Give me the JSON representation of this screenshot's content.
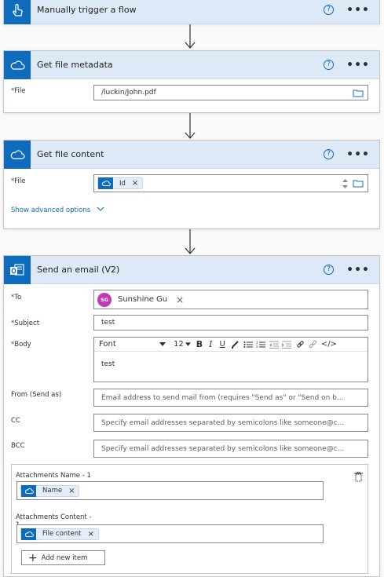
{
  "colors": {
    "accent": "#0f6cbd",
    "header_bg": "#dde9f6",
    "required": "#c50f1f",
    "avatar": "#c239b3"
  },
  "trigger": {
    "title": "Manually trigger a flow",
    "icon": "pointer-hand-icon",
    "help": "?",
    "more": "•••"
  },
  "metadata": {
    "title": "Get file metadata",
    "icon": "onedrive-cloud-icon",
    "help": "?",
    "more": "•••",
    "file_label": "File",
    "file_value": "/luckin/John.pdf"
  },
  "content": {
    "title": "Get file content",
    "icon": "onedrive-cloud-icon",
    "help": "?",
    "more": "•••",
    "file_label": "File",
    "file_token": "Id",
    "advanced": "Show advanced options"
  },
  "email": {
    "title": "Send an email (V2)",
    "icon": "outlook-icon",
    "help": "?",
    "more": "•••",
    "to_label": "To",
    "to_initials": "SG",
    "to_name": "Sunshine Gu",
    "subject_label": "Subject",
    "subject_value": "test",
    "body_label": "Body",
    "font_label": "Font",
    "font_size": "12",
    "body_text": "test",
    "from_label": "From (Send as)",
    "from_placeholder": "Email address to send mail from (requires \"Send as\" or \"Send on b...",
    "cc_label": "CC",
    "cc_placeholder": "Specify email addresses separated by semicolons like someone@c...",
    "bcc_label": "BCC",
    "bcc_placeholder": "Specify email addresses separated by semicolons like someone@c...",
    "att_name_label": "Attachments Name - 1",
    "att_name_token": "Name",
    "att_content_label": "Attachments Content -",
    "att_content_label2": "1",
    "att_content_token": "File content",
    "add_item": "Add new item"
  }
}
